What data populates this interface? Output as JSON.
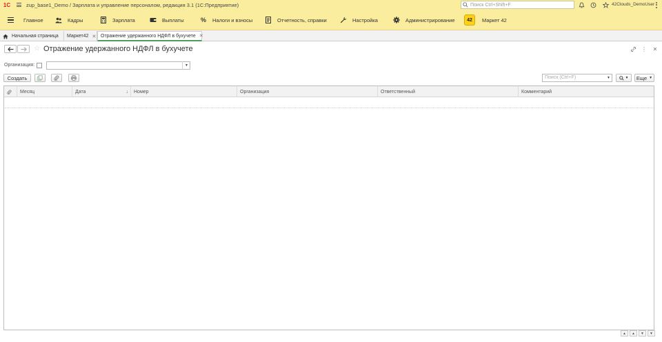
{
  "titlebar": {
    "logo": "1C",
    "title": "zup_base1_Demo / Зарплата и управление персоналом, редакция 3.1  (1С:Предприятие)",
    "search_placeholder": "Поиск Ctrl+Shift+F",
    "user": "42Clouds_DemoUser"
  },
  "menu": {
    "items": [
      {
        "label": "Главное",
        "icon": "menu-icon"
      },
      {
        "label": "Кадры",
        "icon": "people-icon"
      },
      {
        "label": "Зарплата",
        "icon": "calculator-icon"
      },
      {
        "label": "Выплаты",
        "icon": "wallet-icon"
      },
      {
        "label": "Налоги и взносы",
        "icon": "percent-icon"
      },
      {
        "label": "Отчетность, справки",
        "icon": "report-icon"
      },
      {
        "label": "Настройка",
        "icon": "wrench-icon"
      },
      {
        "label": "Администрирование",
        "icon": "gear-icon"
      },
      {
        "label": "Маркет 42",
        "icon": "market42-icon",
        "badge": "42"
      }
    ]
  },
  "tabs": [
    {
      "label": "Начальная страница"
    },
    {
      "label": "Маркет42"
    },
    {
      "label": "Отражение удержанного НДФЛ в бухучете"
    }
  ],
  "form": {
    "title": "Отражение удержанного НДФЛ в бухучете",
    "org_label": "Организация:",
    "org_value": "",
    "create_label": "Создать",
    "search_placeholder": "Поиск (Ctrl+F)",
    "more_label": "Еще"
  },
  "table": {
    "columns": [
      "Месяц",
      "Дата",
      "Номер",
      "Организация",
      "Ответственный",
      "Комментарий"
    ],
    "rows": []
  },
  "colors": {
    "header_bg": "#fbed9e",
    "active_tab_accent": "#4a9c57"
  }
}
